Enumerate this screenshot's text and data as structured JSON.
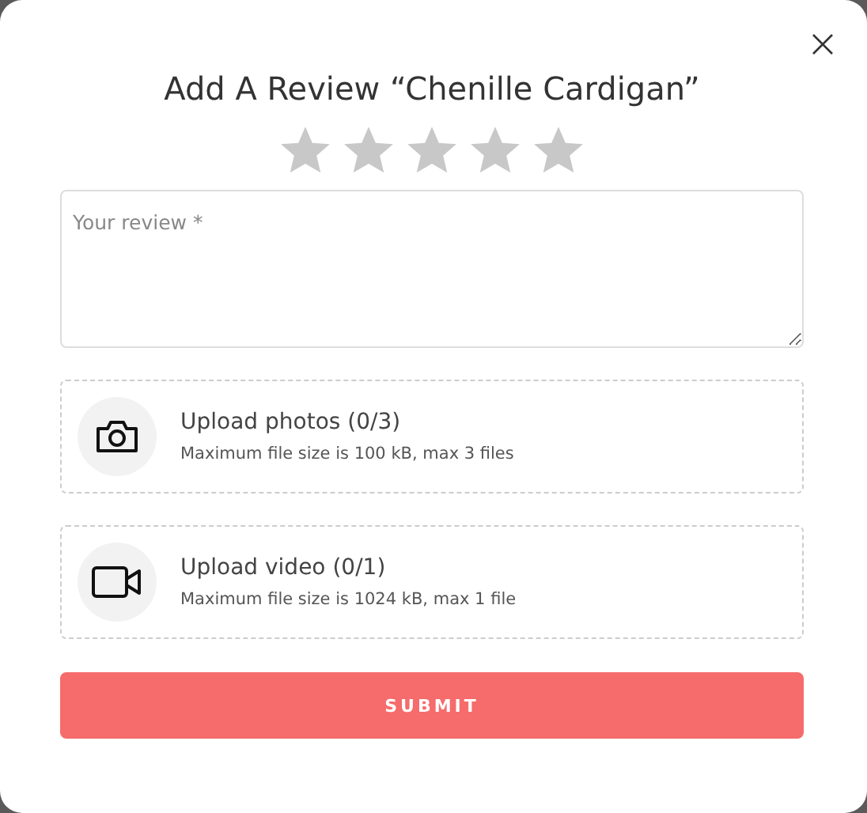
{
  "dialog": {
    "title": "Add A Review “Chenille Cardigan”"
  },
  "rating": {
    "stars": 0
  },
  "review": {
    "placeholder": "Your review *"
  },
  "uploads": [
    {
      "kind": "photo",
      "title": "Upload photos (0/3)",
      "hint": "Maximum file size is 100 kB, max 3 files"
    },
    {
      "kind": "video",
      "title": "Upload video (0/1)",
      "hint": "Maximum file size is 1024 kB, max 1 file"
    }
  ],
  "submit": "SUBMIT"
}
